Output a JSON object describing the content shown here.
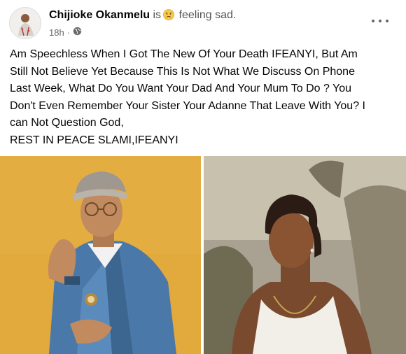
{
  "post": {
    "author": "Chijioke Okanmelu",
    "is_word": "is",
    "feeling_word": "feeling",
    "feeling": "sad.",
    "time": "18h",
    "dot": "·",
    "privacy_icon": "globe-icon",
    "feeling_icon": "sad-face-emoji",
    "text_lines": [
      "Am Speechless  When I Got The New Of Your Death IFEANYI, But Am",
      "Still Not Believe Yet Because This Is Not What We Discuss On Phone",
      "Last Week, What Do You Want Your Dad And Your Mum To Do ? You",
      "Don't Even Remember Your Sister Your Adanne That Leave With You? I",
      "can Not Question God,",
      "REST IN PEACE SLAMI,IFEANYI"
    ]
  },
  "colors": {
    "photo_left_bg": "#e2a93d",
    "photo_right_bg": "#a9a293",
    "meta_gray": "#65676b"
  }
}
